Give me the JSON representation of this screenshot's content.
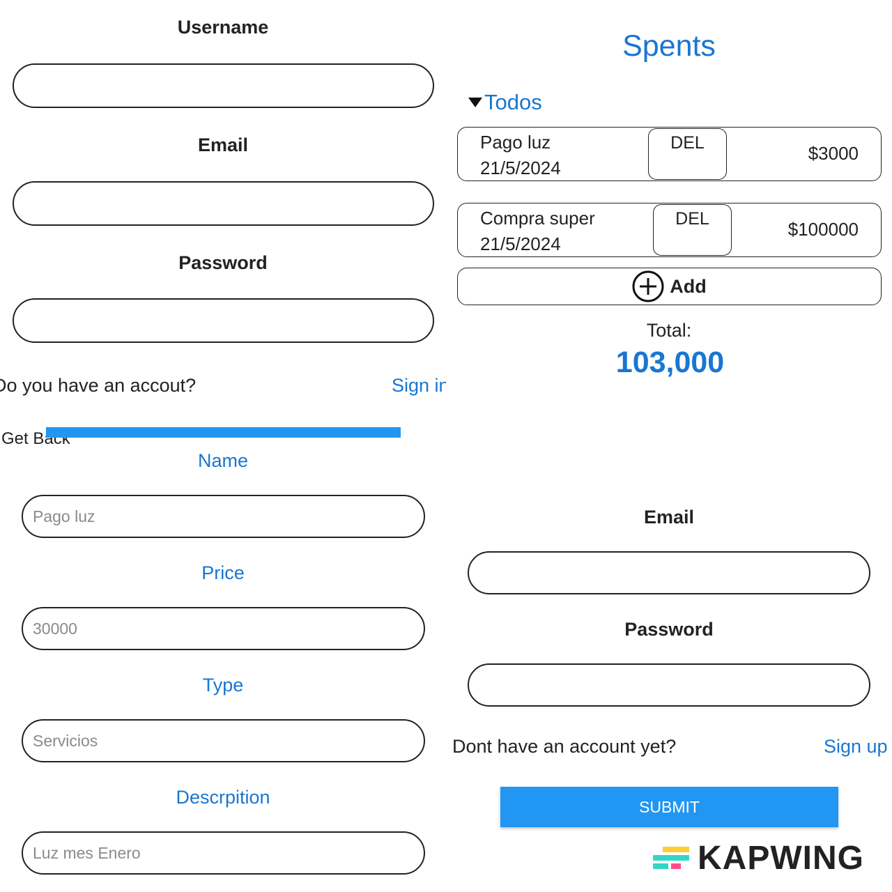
{
  "register": {
    "username_label": "Username",
    "email_label": "Email",
    "password_label": "Password",
    "account_question": "Do you have an accout?",
    "sign_in_link": "Sign in",
    "get_back": "Get Back"
  },
  "spents": {
    "title": "Spents",
    "filter_label": "Todos",
    "items": [
      {
        "name": "Pago luz",
        "date": "21/5/2024",
        "del_label": "DEL",
        "price": "$3000"
      },
      {
        "name": "Compra super",
        "date": "21/5/2024",
        "del_label": "DEL",
        "price": "$100000"
      }
    ],
    "add_label": "Add",
    "total_label": "Total:",
    "total_value": "103,000"
  },
  "add_form": {
    "name_label": "Name",
    "name_placeholder": "Pago luz",
    "price_label": "Price",
    "price_placeholder": "30000",
    "type_label": "Type",
    "type_placeholder": "Servicios",
    "description_label": "Descrpition",
    "description_placeholder": "Luz mes Enero"
  },
  "login": {
    "email_label": "Email",
    "password_label": "Password",
    "account_question": "Dont have an account yet?",
    "sign_up_link": "Sign up",
    "submit_label": "SUBMIT"
  },
  "watermark": {
    "text": "KAPWING",
    "colors": [
      "#ffcc33",
      "#33d6c4",
      "#ff4f8b"
    ]
  },
  "colors": {
    "accent_blue": "#1976d2",
    "button_blue": "#2196f3"
  }
}
